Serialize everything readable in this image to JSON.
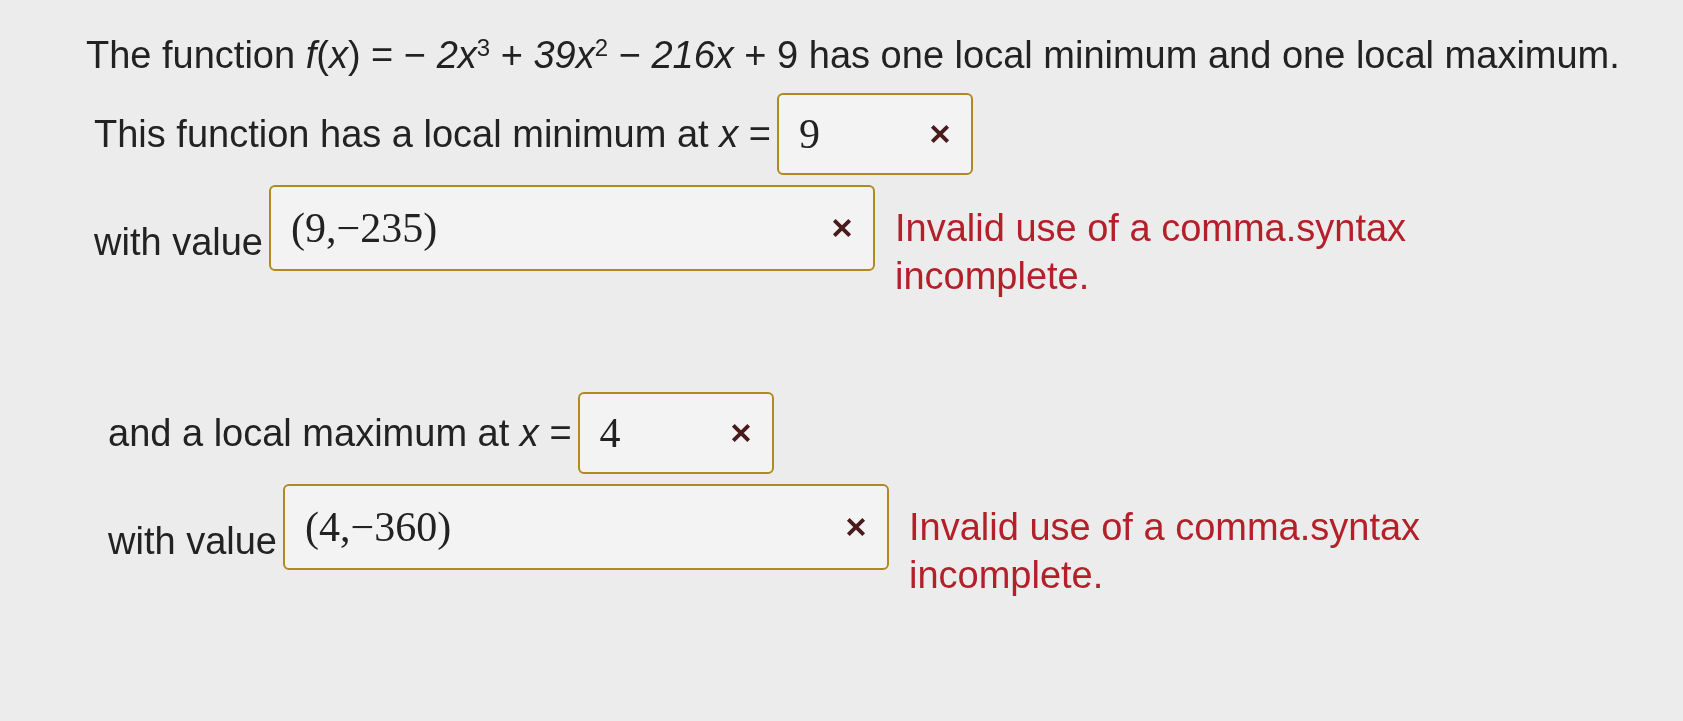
{
  "intro": "The function *f*(*x*) = − *2x*$^{3}$ + *39x*$^{2}$ − *216x* + 9 has one local minimum and one local maximum.",
  "parts": [
    {
      "kind": "point",
      "prompt": "This function has a local minimum at *x* =",
      "answer": "9",
      "correct": false
    },
    {
      "kind": "value",
      "prompt": "with value",
      "answer": "(9,−235)",
      "correct": false,
      "error": "Invalid use of a comma.syntax incomplete."
    },
    {
      "kind": "point",
      "prompt": "and a local maximum at *x* =",
      "answer": "4",
      "correct": false
    },
    {
      "kind": "value",
      "prompt": "with value",
      "answer": "(4,−360)",
      "correct": false,
      "error": "Invalid use of a comma.syntax incomplete."
    }
  ]
}
